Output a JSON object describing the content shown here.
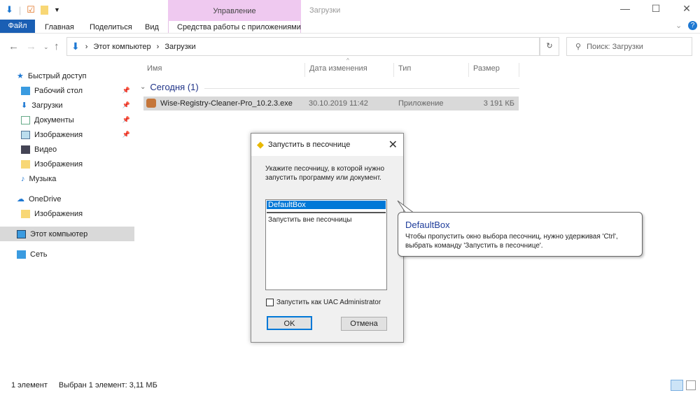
{
  "window": {
    "title": "Загрузки",
    "context_group": "Управление",
    "min": "—",
    "max": "☐",
    "close": "✕"
  },
  "ribbon": {
    "tabs": [
      "Файл",
      "Главная",
      "Поделиться",
      "Вид",
      "Средства работы с приложениями"
    ],
    "help": "?",
    "expand": "⌄"
  },
  "address": {
    "crumbs": [
      "Этот компьютер",
      "Загрузки"
    ],
    "search_placeholder": "Поиск: Загрузки"
  },
  "sidebar": {
    "items": [
      {
        "label": "Быстрый доступ",
        "icon": "star-icon"
      },
      {
        "label": "Рабочий стол",
        "icon": "desktop-icon",
        "pinned": true
      },
      {
        "label": "Загрузки",
        "icon": "download-icon",
        "pinned": true
      },
      {
        "label": "Документы",
        "icon": "document-icon",
        "pinned": true
      },
      {
        "label": "Изображения",
        "icon": "pictures-icon",
        "pinned": true
      },
      {
        "label": "Видео",
        "icon": "video-icon"
      },
      {
        "label": "Изображения",
        "icon": "folder-icon"
      },
      {
        "label": "Музыка",
        "icon": "music-icon"
      },
      {
        "label": "OneDrive",
        "icon": "cloud-icon"
      },
      {
        "label": "Изображения",
        "icon": "folder-icon"
      },
      {
        "label": "Этот компьютер",
        "icon": "computer-icon",
        "selected": true
      },
      {
        "label": "Сеть",
        "icon": "network-icon"
      }
    ]
  },
  "columns": [
    "Имя",
    "Дата изменения",
    "Тип",
    "Размер"
  ],
  "group": "Сегодня (1)",
  "files": [
    {
      "name": "Wise-Registry-Cleaner-Pro_10.2.3.exe",
      "date": "30.10.2019 11:42",
      "type": "Приложение",
      "size": "3 191 КБ"
    }
  ],
  "status": {
    "count": "1 элемент",
    "selected": "Выбран 1 элемент: 3,11 МБ"
  },
  "dialog": {
    "title": "Запустить в песочнице",
    "prompt": "Укажите песочницу, в которой нужно запустить программу или документ.",
    "options": [
      "DefaultBox",
      "Запустить вне песочницы"
    ],
    "selected": "DefaultBox",
    "uac_label": "Запустить как UAC Administrator",
    "uac_checked": false,
    "ok": "OK",
    "cancel": "Отмена"
  },
  "tooltip": {
    "title": "DefaultBox",
    "text": "Чтобы пропустить окно выбора песочниц, нужно удерживая 'Ctrl', выбрать команду 'Запустить в песочнице'."
  }
}
